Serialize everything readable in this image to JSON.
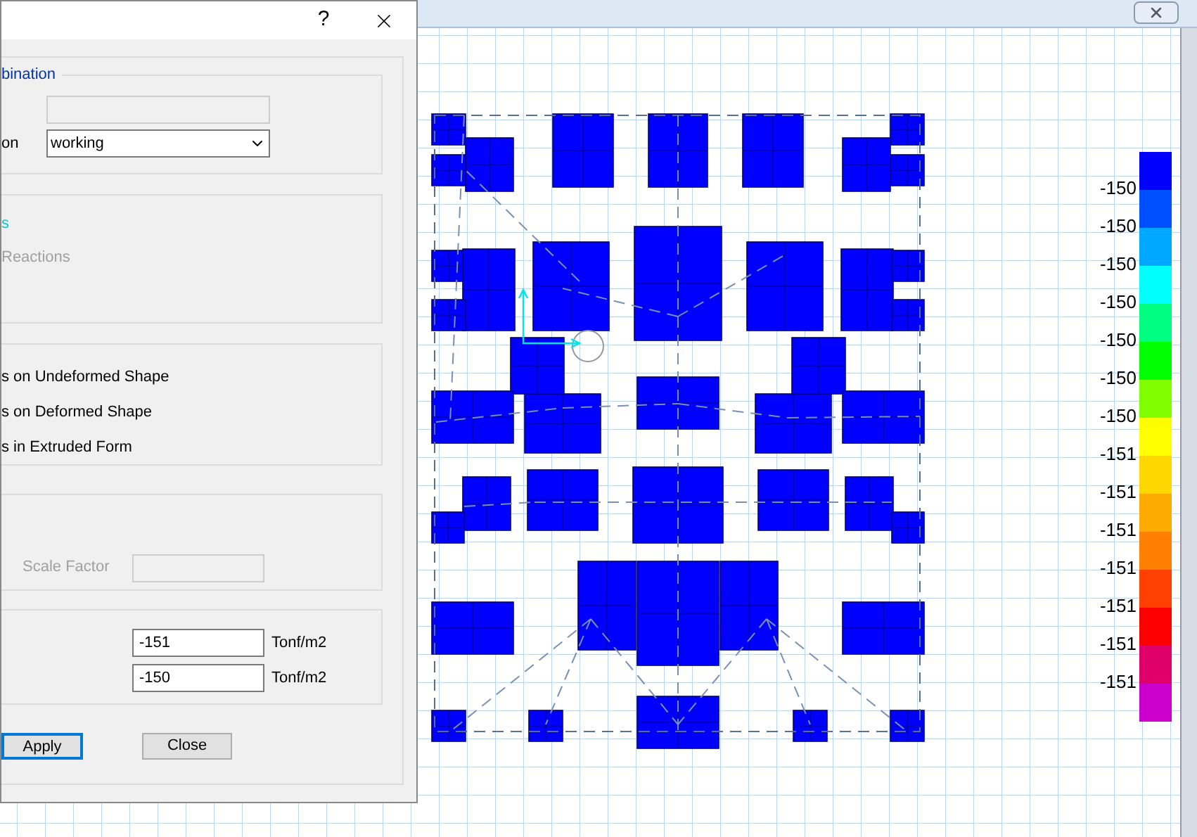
{
  "dialog": {
    "help": "?",
    "combination_group": {
      "title": "bination",
      "name_field": {
        "disabled": true
      },
      "combination": {
        "label": "on",
        "value": "working"
      }
    },
    "display_group": {
      "title": "s",
      "reactions": {
        "label": "Reactions",
        "disabled": true
      }
    },
    "contour_options": [
      "s on Undeformed Shape",
      "s on Deformed Shape",
      "s in Extruded Form"
    ],
    "scale_group": {
      "scale_factor": {
        "label": "Scale Factor",
        "disabled": true
      }
    },
    "range_group": {
      "fields": [
        {
          "value": "-151",
          "unit": "Tonf/m2"
        },
        {
          "value": "-150",
          "unit": "Tonf/m2"
        }
      ]
    },
    "buttons": [
      {
        "label": "Apply",
        "default": true
      },
      {
        "label": "Close",
        "default": false
      }
    ]
  },
  "legend": {
    "swatches": [
      {
        "color": "#0000ff"
      },
      {
        "color": "#0050ff"
      },
      {
        "color": "#00a8ff"
      },
      {
        "color": "#00ffff"
      },
      {
        "color": "#00ff80"
      },
      {
        "color": "#00ff00"
      },
      {
        "color": "#80ff00"
      },
      {
        "color": "#ffff00"
      },
      {
        "color": "#ffd700"
      },
      {
        "color": "#ffaa00"
      },
      {
        "color": "#ff8000"
      },
      {
        "color": "#ff4000"
      },
      {
        "color": "#ff0000"
      },
      {
        "color": "#e0006a"
      },
      {
        "color": "#cc00cc"
      }
    ],
    "labels": [
      "-150",
      "-150",
      "-150",
      "-150",
      "-150",
      "-150",
      "-150",
      "-151",
      "-151",
      "-151",
      "-151",
      "-151",
      "-151",
      "-151"
    ]
  }
}
